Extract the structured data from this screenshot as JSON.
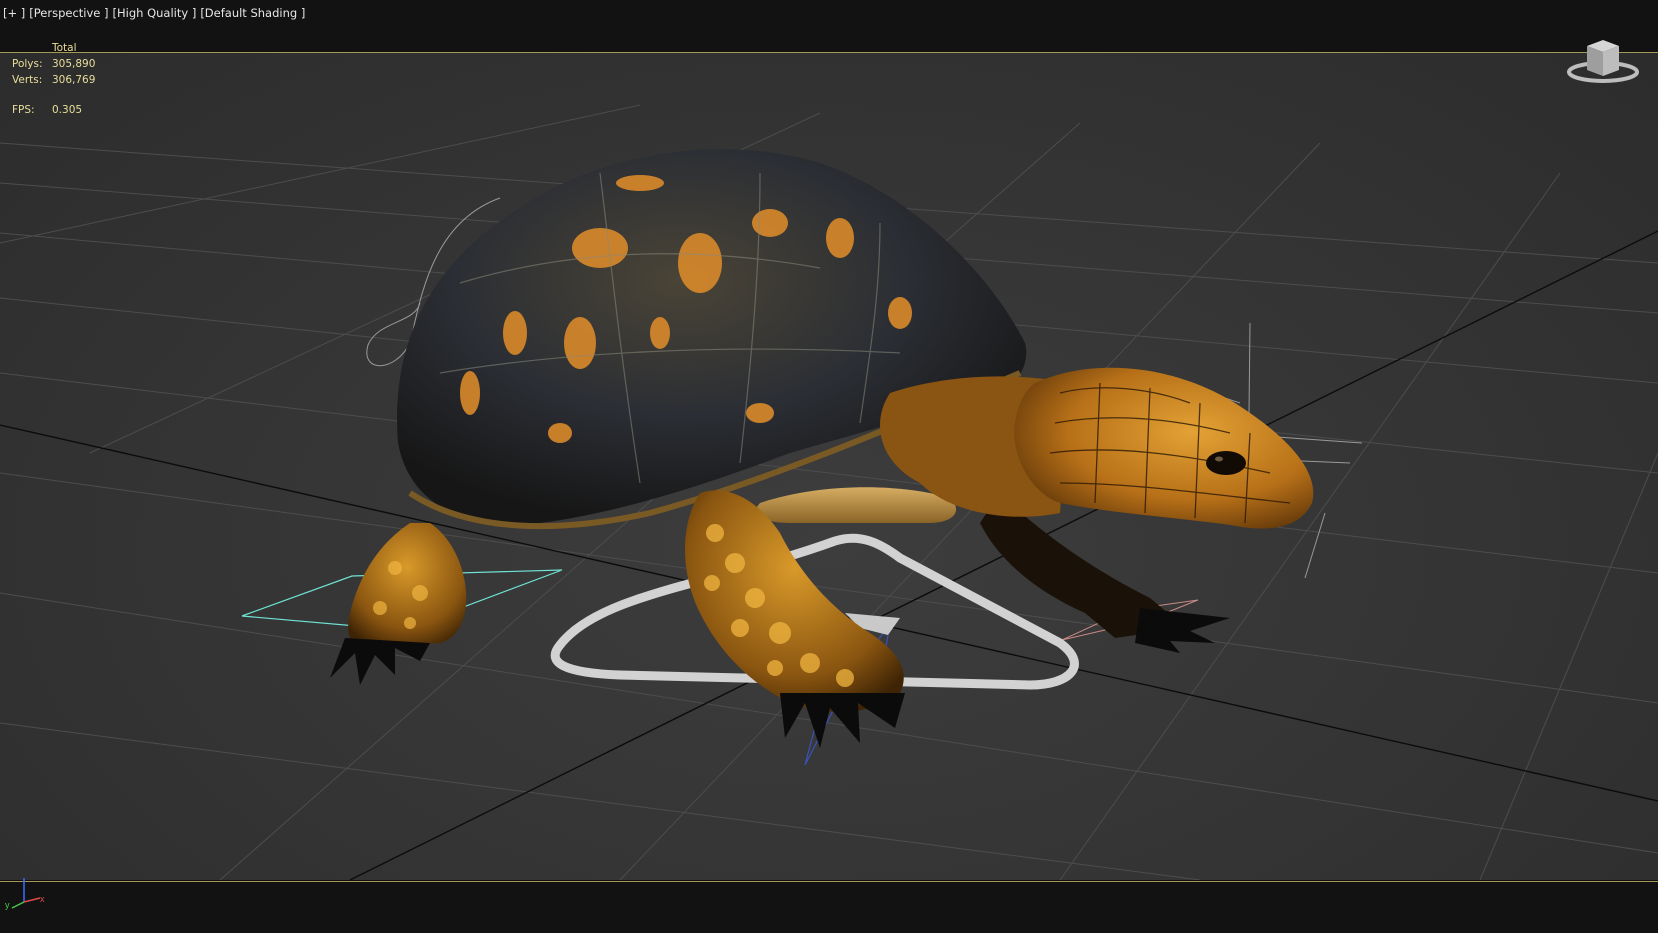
{
  "viewport_label": {
    "plus": "[+ ]",
    "view": "[Perspective ]",
    "quality": "[High Quality ]",
    "shading": "[Default Shading ]"
  },
  "stats": {
    "header": "Total",
    "polys_label": "Polys:",
    "polys_value": "305,890",
    "verts_label": "Verts:",
    "verts_value": "306,769",
    "fps_label": "FPS:",
    "fps_value": "0.305"
  },
  "axis_tripod": {
    "x_label": "x",
    "y_label": "y"
  },
  "colors": {
    "stats_text": "#e9df9a",
    "viewport_border": "#a59a55",
    "grid": "#4a4a4a",
    "shell_dark": "#2a2f38",
    "skin_orange": "#d9922a",
    "selection_cyan": "#6fe3d4"
  }
}
